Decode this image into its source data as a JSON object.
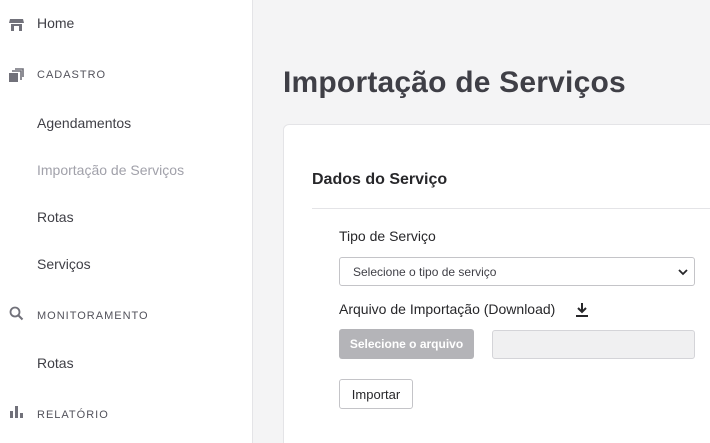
{
  "sidebar": {
    "home": {
      "label": "Home",
      "icon": "store-icon"
    },
    "sections": [
      {
        "title": "CADASTRO",
        "icon": "stack-icon",
        "items": [
          {
            "label": "Agendamentos",
            "active": false
          },
          {
            "label": "Importação de Serviços",
            "active": true
          },
          {
            "label": "Rotas",
            "active": false
          },
          {
            "label": "Serviços",
            "active": false
          }
        ]
      },
      {
        "title": "MONITORAMENTO",
        "icon": "search-icon",
        "items": [
          {
            "label": "Rotas",
            "active": false
          }
        ]
      },
      {
        "title": "RELATÓRIO",
        "icon": "bar-chart-icon",
        "items": []
      }
    ]
  },
  "main": {
    "title": "Importação de Serviços",
    "card": {
      "title": "Dados do Serviço",
      "service_type": {
        "label": "Tipo de Serviço",
        "selected": "Selecione o tipo de serviço"
      },
      "import_file": {
        "label": "Arquivo de Importação (Download)",
        "button": "Selecione o arquivo",
        "file_name": ""
      },
      "import_button": "Importar"
    }
  },
  "colors": {
    "sidebar_bg": "#ffffff",
    "page_bg": "#f4f4f5",
    "text": "#3f3f46",
    "muted": "#a1a1aa",
    "file_button": "#b4b4b8"
  }
}
